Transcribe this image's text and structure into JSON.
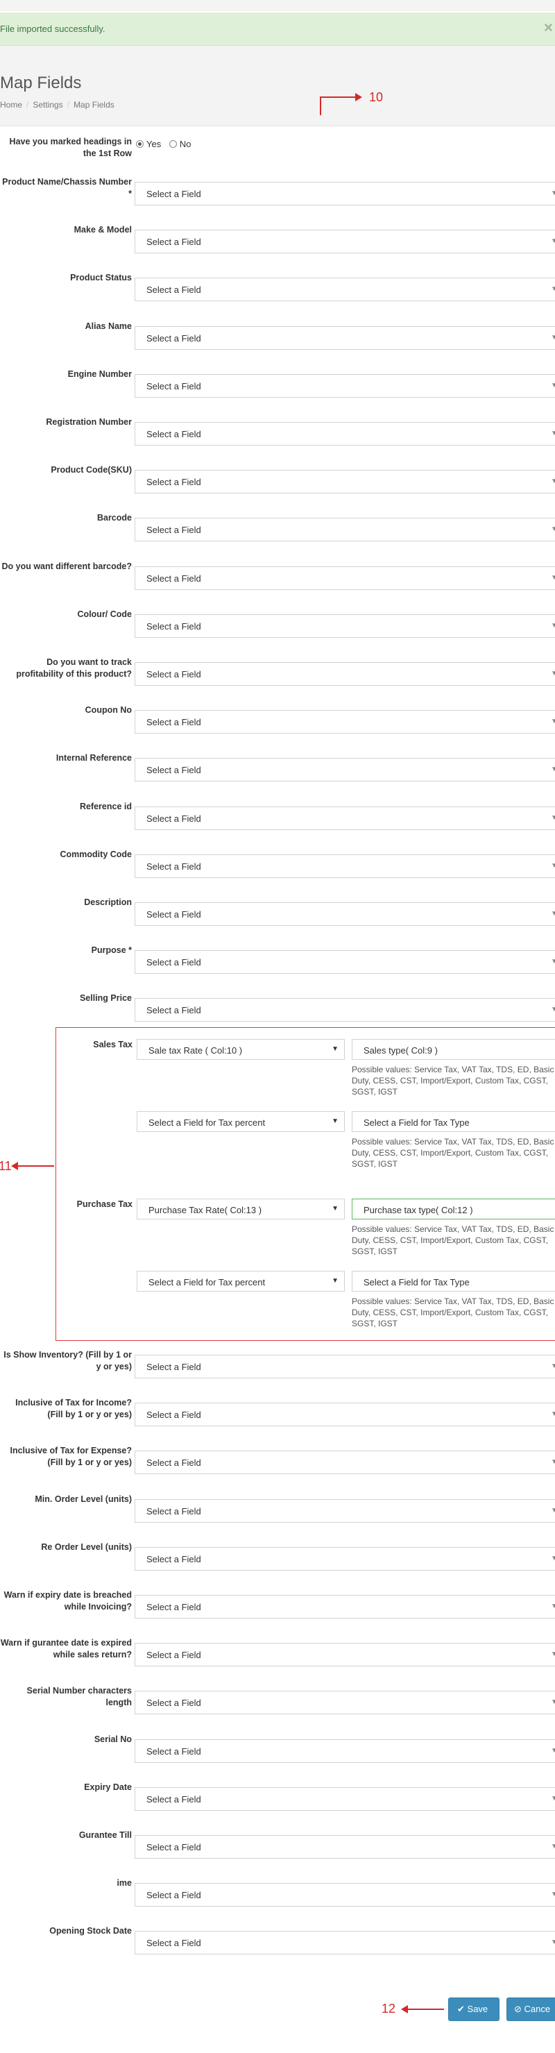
{
  "alert": {
    "message": "File imported successfully.",
    "close": "×"
  },
  "header": {
    "title": "Map Fields",
    "breadcrumb": [
      "Home",
      "Settings",
      "Map Fields"
    ]
  },
  "annotations": {
    "a10": "10",
    "a11": "11",
    "a12": "12"
  },
  "headings_question": {
    "label": "Have you marked headings in the 1st Row",
    "options": [
      "Yes",
      "No"
    ],
    "selected": "Yes"
  },
  "fields": [
    {
      "label": "Product Name/Chassis Number *",
      "value": "Select a Field"
    },
    {
      "label": "Make & Model",
      "value": "Select a Field"
    },
    {
      "label": "Product Status",
      "value": "Select a Field"
    },
    {
      "label": "Alias Name",
      "value": "Select a Field"
    },
    {
      "label": "Engine Number",
      "value": "Select a Field"
    },
    {
      "label": "Registration Number",
      "value": "Select a Field"
    },
    {
      "label": "Product Code(SKU)",
      "value": "Select a Field"
    },
    {
      "label": "Barcode",
      "value": "Select a Field"
    },
    {
      "label": "Do you want different barcode?",
      "value": "Select a Field"
    },
    {
      "label": "Colour/ Code",
      "value": "Select a Field"
    },
    {
      "label": "Do you want to track profitability of this product?",
      "value": "Select a Field"
    },
    {
      "label": "Coupon No",
      "value": "Select a Field"
    },
    {
      "label": "Internal Reference",
      "value": "Select a Field"
    },
    {
      "label": "Reference id",
      "value": "Select a Field"
    },
    {
      "label": "Commodity Code",
      "value": "Select a Field"
    },
    {
      "label": "Description",
      "value": "Select a Field"
    },
    {
      "label": "Purpose *",
      "value": "Select a Field"
    },
    {
      "label": "Selling Price",
      "value": "Select a Field"
    }
  ],
  "tax": {
    "sales_label": "Sales Tax",
    "purchase_label": "Purchase Tax",
    "sales_rate": "Sale tax Rate ( Col:10 )",
    "sales_type": "Sales type( Col:9 )",
    "sales_percent2": "Select a Field for Tax percent",
    "sales_type2": "Select a Field for Tax Type",
    "purchase_rate": "Purchase Tax Rate( Col:13 )",
    "purchase_type": "Purchase tax type( Col:12 )",
    "purchase_percent2": "Select a Field for Tax percent",
    "purchase_type2": "Select a Field for Tax Type",
    "help": "Possible values: Service Tax, VAT Tax, TDS, ED, Basic Duty, CESS, CST, Import/Export, Custom Tax, CGST, SGST, IGST"
  },
  "fields2": [
    {
      "label": "Is Show Inventory? (Fill by 1 or y or yes)",
      "value": "Select a Field"
    },
    {
      "label": "Inclusive of Tax for Income? (Fill by 1 or y or yes)",
      "value": "Select a Field"
    },
    {
      "label": "Inclusive of Tax for Expense? (Fill by 1 or y or yes)",
      "value": "Select a Field"
    },
    {
      "label": "Min. Order Level (units)",
      "value": "Select a Field"
    },
    {
      "label": "Re Order Level (units)",
      "value": "Select a Field"
    },
    {
      "label": "Warn if expiry date is breached while Invoicing?",
      "value": "Select a Field"
    },
    {
      "label": "Warn if gurantee date is expired while sales return?",
      "value": "Select a Field"
    },
    {
      "label": "Serial Number characters length",
      "value": "Select a Field"
    },
    {
      "label": "Serial No",
      "value": "Select a Field"
    },
    {
      "label": "Expiry Date",
      "value": "Select a Field"
    },
    {
      "label": "Gurantee Till",
      "value": "Select a Field"
    },
    {
      "label": "ime",
      "value": "Select a Field"
    },
    {
      "label": "Opening Stock Date",
      "value": "Select a Field"
    }
  ],
  "buttons": {
    "save": "Save",
    "cancel": "Cance"
  },
  "colors": {
    "accent": "#3c8dbc",
    "annotation": "#d62828",
    "success_bg": "#dff0d8"
  }
}
